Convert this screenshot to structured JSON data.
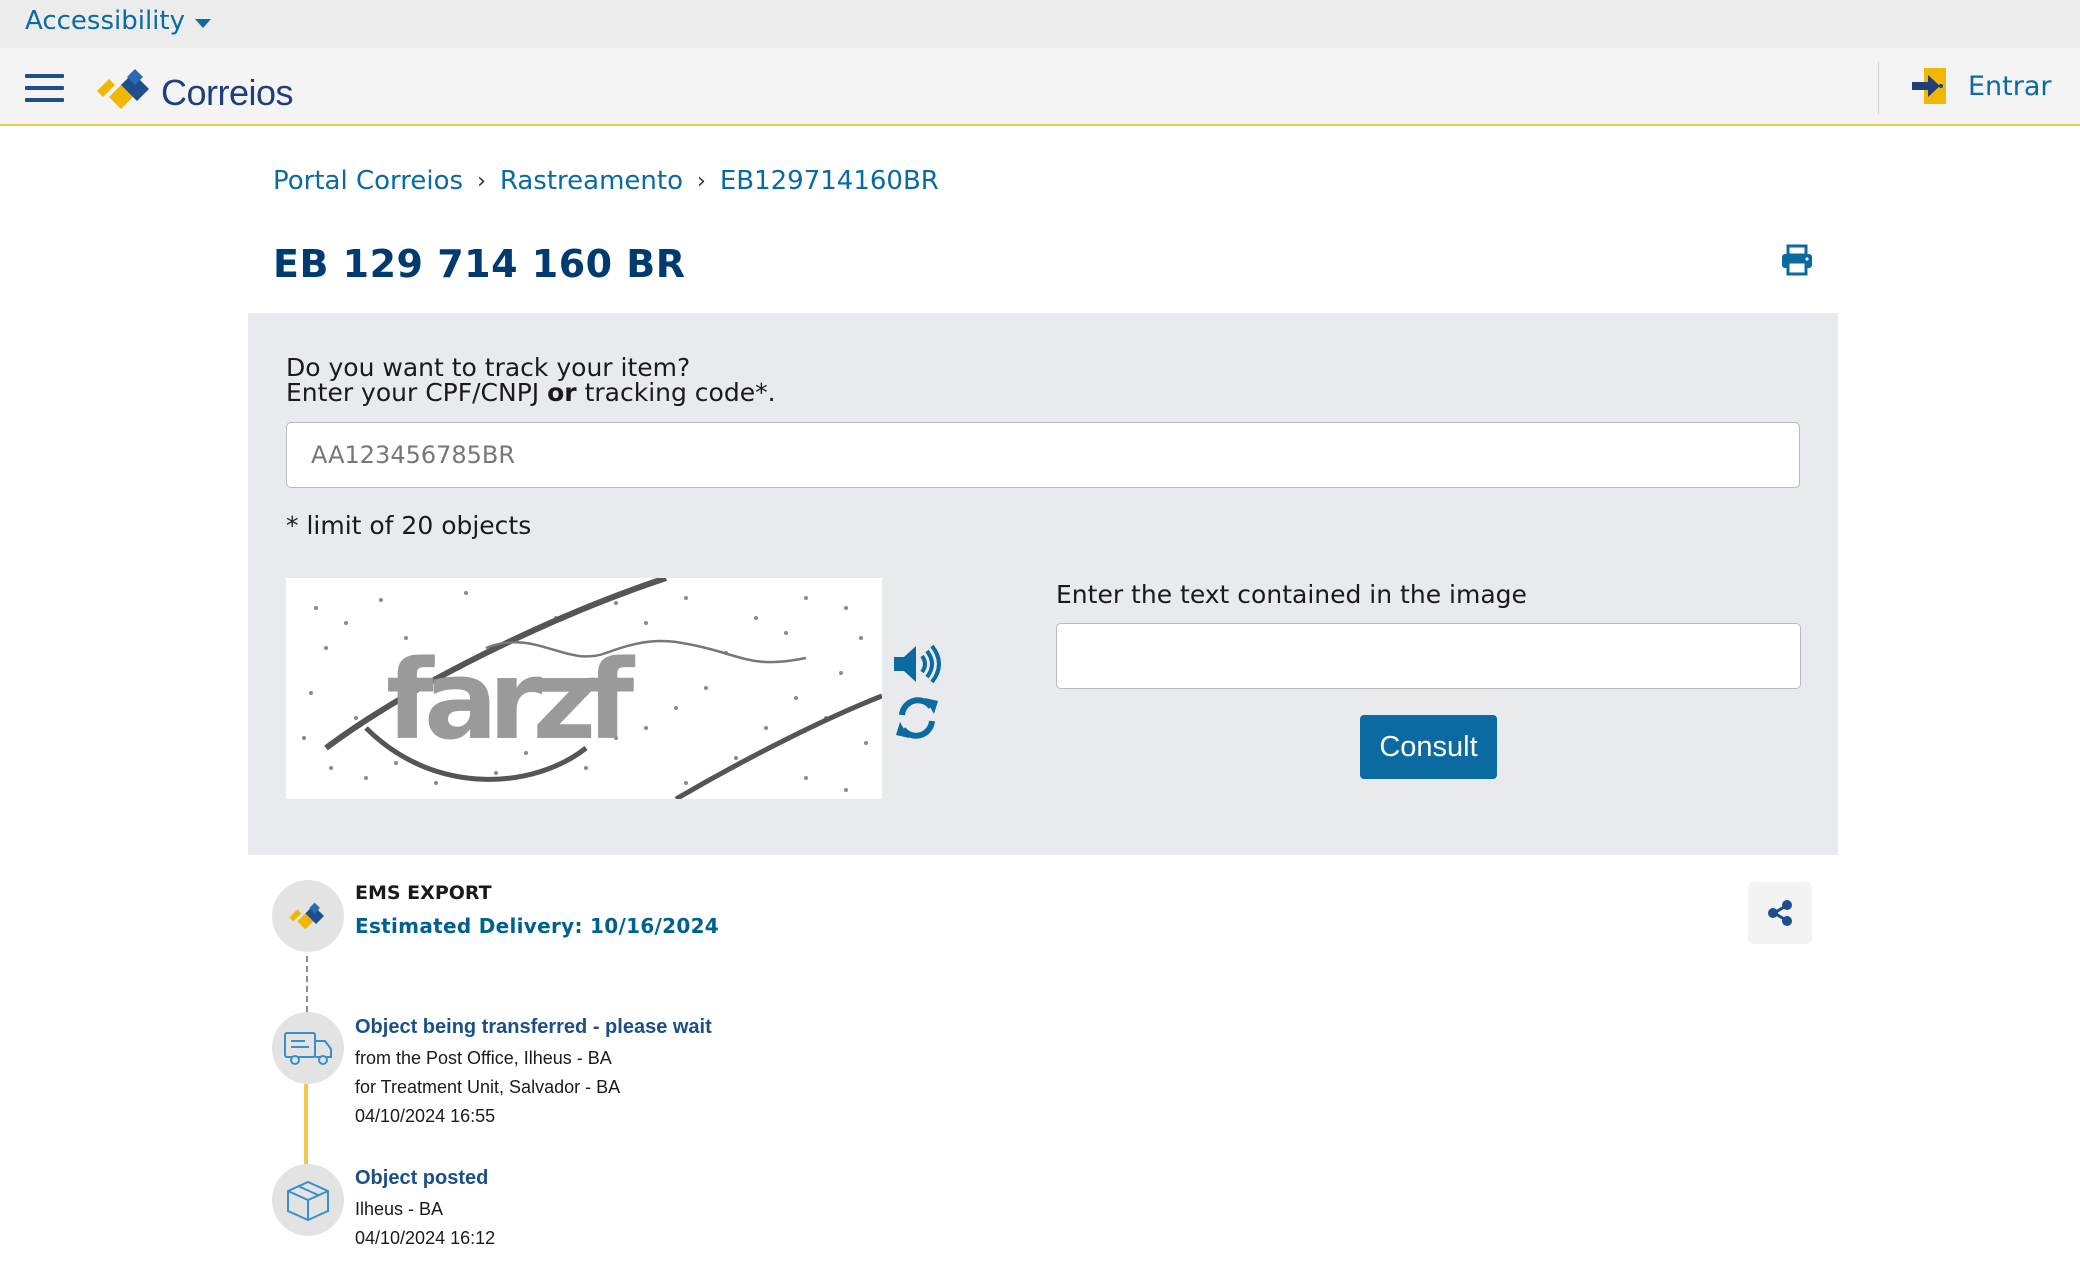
{
  "accessibility": {
    "label": "Accessibility"
  },
  "header": {
    "logo_text": "Correios",
    "login_label": "Entrar"
  },
  "breadcrumb": [
    {
      "label": "Portal Correios"
    },
    {
      "label": "Rastreamento"
    },
    {
      "label": "EB129714160BR"
    }
  ],
  "page": {
    "title": "EB 129 714 160 BR"
  },
  "form": {
    "question_line1": "Do you want to track your item?",
    "question_line2_a": "Enter your CPF/CNPJ ",
    "question_line2_or": "or",
    "question_line2_b": " tracking code*.",
    "placeholder": "AA123456785BR",
    "limit_note": "* limit of 20 objects",
    "captcha_text": "farzf",
    "captcha_label": "Enter the text contained in the image",
    "consult_label": "Consult"
  },
  "tracking": {
    "service": "EMS EXPORT",
    "estimate": "Estimated Delivery: 10/16/2024",
    "events": [
      {
        "title": "Object being transferred - please wait",
        "lines": [
          "from the Post Office, Ilheus - BA",
          "for Treatment Unit, Salvador - BA",
          "04/10/2024 16:55"
        ],
        "icon": "truck-icon"
      },
      {
        "title": "Object posted",
        "lines": [
          "Ilheus - BA",
          "04/10/2024 16:12"
        ],
        "icon": "package-icon"
      }
    ]
  },
  "colors": {
    "brand_blue": "#0a6aa1",
    "title_navy": "#003a70",
    "brand_yellow": "#f2c94c",
    "panel_gray": "#e9eaee"
  }
}
